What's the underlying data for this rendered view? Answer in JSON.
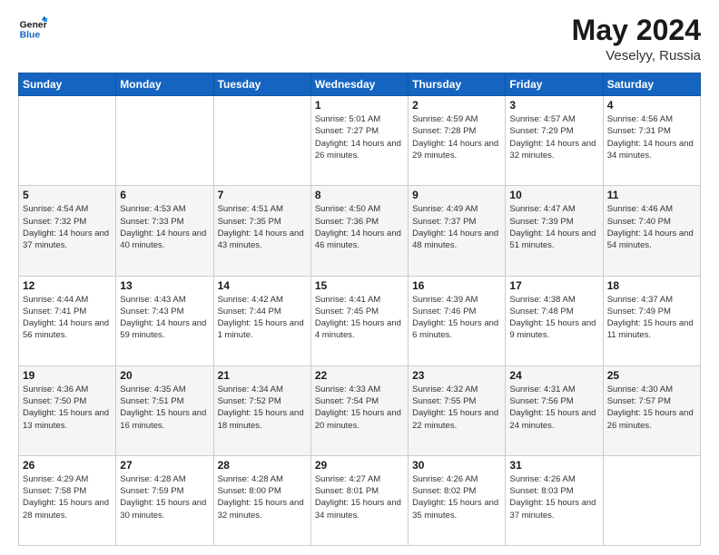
{
  "header": {
    "logo_line1": "General",
    "logo_line2": "Blue",
    "month_year": "May 2024",
    "location": "Veselyy, Russia"
  },
  "days_of_week": [
    "Sunday",
    "Monday",
    "Tuesday",
    "Wednesday",
    "Thursday",
    "Friday",
    "Saturday"
  ],
  "weeks": [
    [
      {
        "day": "",
        "info": ""
      },
      {
        "day": "",
        "info": ""
      },
      {
        "day": "",
        "info": ""
      },
      {
        "day": "1",
        "info": "Sunrise: 5:01 AM\nSunset: 7:27 PM\nDaylight: 14 hours\nand 26 minutes."
      },
      {
        "day": "2",
        "info": "Sunrise: 4:59 AM\nSunset: 7:28 PM\nDaylight: 14 hours\nand 29 minutes."
      },
      {
        "day": "3",
        "info": "Sunrise: 4:57 AM\nSunset: 7:29 PM\nDaylight: 14 hours\nand 32 minutes."
      },
      {
        "day": "4",
        "info": "Sunrise: 4:56 AM\nSunset: 7:31 PM\nDaylight: 14 hours\nand 34 minutes."
      }
    ],
    [
      {
        "day": "5",
        "info": "Sunrise: 4:54 AM\nSunset: 7:32 PM\nDaylight: 14 hours\nand 37 minutes."
      },
      {
        "day": "6",
        "info": "Sunrise: 4:53 AM\nSunset: 7:33 PM\nDaylight: 14 hours\nand 40 minutes."
      },
      {
        "day": "7",
        "info": "Sunrise: 4:51 AM\nSunset: 7:35 PM\nDaylight: 14 hours\nand 43 minutes."
      },
      {
        "day": "8",
        "info": "Sunrise: 4:50 AM\nSunset: 7:36 PM\nDaylight: 14 hours\nand 46 minutes."
      },
      {
        "day": "9",
        "info": "Sunrise: 4:49 AM\nSunset: 7:37 PM\nDaylight: 14 hours\nand 48 minutes."
      },
      {
        "day": "10",
        "info": "Sunrise: 4:47 AM\nSunset: 7:39 PM\nDaylight: 14 hours\nand 51 minutes."
      },
      {
        "day": "11",
        "info": "Sunrise: 4:46 AM\nSunset: 7:40 PM\nDaylight: 14 hours\nand 54 minutes."
      }
    ],
    [
      {
        "day": "12",
        "info": "Sunrise: 4:44 AM\nSunset: 7:41 PM\nDaylight: 14 hours\nand 56 minutes."
      },
      {
        "day": "13",
        "info": "Sunrise: 4:43 AM\nSunset: 7:43 PM\nDaylight: 14 hours\nand 59 minutes."
      },
      {
        "day": "14",
        "info": "Sunrise: 4:42 AM\nSunset: 7:44 PM\nDaylight: 15 hours\nand 1 minute."
      },
      {
        "day": "15",
        "info": "Sunrise: 4:41 AM\nSunset: 7:45 PM\nDaylight: 15 hours\nand 4 minutes."
      },
      {
        "day": "16",
        "info": "Sunrise: 4:39 AM\nSunset: 7:46 PM\nDaylight: 15 hours\nand 6 minutes."
      },
      {
        "day": "17",
        "info": "Sunrise: 4:38 AM\nSunset: 7:48 PM\nDaylight: 15 hours\nand 9 minutes."
      },
      {
        "day": "18",
        "info": "Sunrise: 4:37 AM\nSunset: 7:49 PM\nDaylight: 15 hours\nand 11 minutes."
      }
    ],
    [
      {
        "day": "19",
        "info": "Sunrise: 4:36 AM\nSunset: 7:50 PM\nDaylight: 15 hours\nand 13 minutes."
      },
      {
        "day": "20",
        "info": "Sunrise: 4:35 AM\nSunset: 7:51 PM\nDaylight: 15 hours\nand 16 minutes."
      },
      {
        "day": "21",
        "info": "Sunrise: 4:34 AM\nSunset: 7:52 PM\nDaylight: 15 hours\nand 18 minutes."
      },
      {
        "day": "22",
        "info": "Sunrise: 4:33 AM\nSunset: 7:54 PM\nDaylight: 15 hours\nand 20 minutes."
      },
      {
        "day": "23",
        "info": "Sunrise: 4:32 AM\nSunset: 7:55 PM\nDaylight: 15 hours\nand 22 minutes."
      },
      {
        "day": "24",
        "info": "Sunrise: 4:31 AM\nSunset: 7:56 PM\nDaylight: 15 hours\nand 24 minutes."
      },
      {
        "day": "25",
        "info": "Sunrise: 4:30 AM\nSunset: 7:57 PM\nDaylight: 15 hours\nand 26 minutes."
      }
    ],
    [
      {
        "day": "26",
        "info": "Sunrise: 4:29 AM\nSunset: 7:58 PM\nDaylight: 15 hours\nand 28 minutes."
      },
      {
        "day": "27",
        "info": "Sunrise: 4:28 AM\nSunset: 7:59 PM\nDaylight: 15 hours\nand 30 minutes."
      },
      {
        "day": "28",
        "info": "Sunrise: 4:28 AM\nSunset: 8:00 PM\nDaylight: 15 hours\nand 32 minutes."
      },
      {
        "day": "29",
        "info": "Sunrise: 4:27 AM\nSunset: 8:01 PM\nDaylight: 15 hours\nand 34 minutes."
      },
      {
        "day": "30",
        "info": "Sunrise: 4:26 AM\nSunset: 8:02 PM\nDaylight: 15 hours\nand 35 minutes."
      },
      {
        "day": "31",
        "info": "Sunrise: 4:26 AM\nSunset: 8:03 PM\nDaylight: 15 hours\nand 37 minutes."
      },
      {
        "day": "",
        "info": ""
      }
    ]
  ]
}
